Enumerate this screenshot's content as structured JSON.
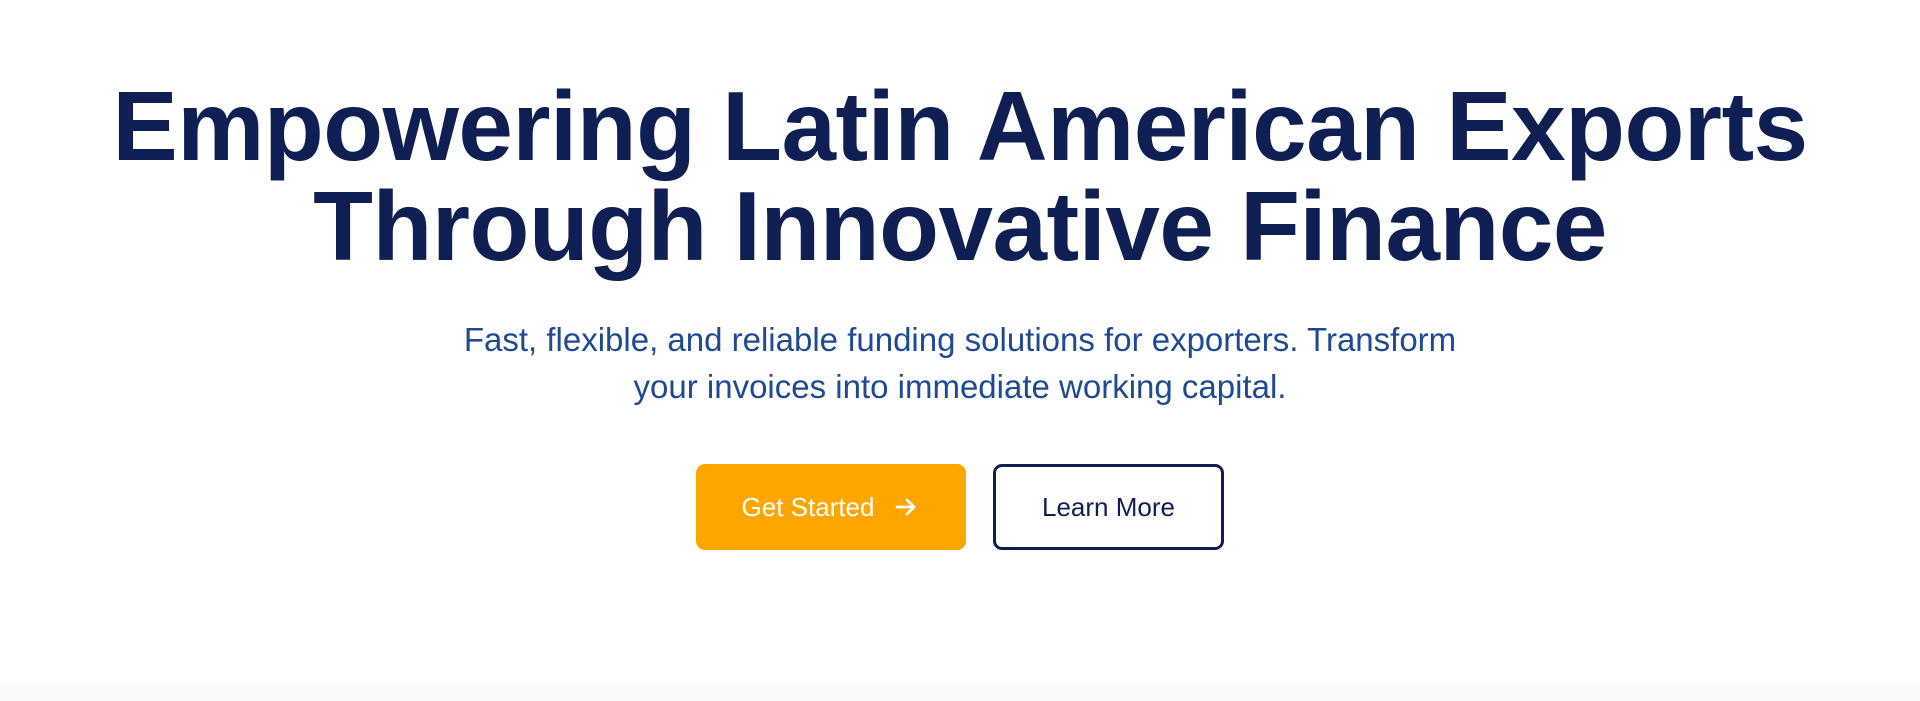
{
  "hero": {
    "headline_line1": "Empowering Latin American Exports",
    "headline_line2": "Through Innovative Finance",
    "subtitle_line1": "Fast, flexible, and reliable funding solutions for exporters. Transform",
    "subtitle_line2": "your invoices into immediate working capital.",
    "primary_button_label": "Get Started",
    "primary_button_icon": "arrow-right-icon",
    "secondary_button_label": "Learn More"
  },
  "colors": {
    "headline": "#0f1f54",
    "subtitle": "#1e4a93",
    "accent": "#ffa500",
    "outline": "#0f1f54",
    "background": "#ffffff"
  }
}
